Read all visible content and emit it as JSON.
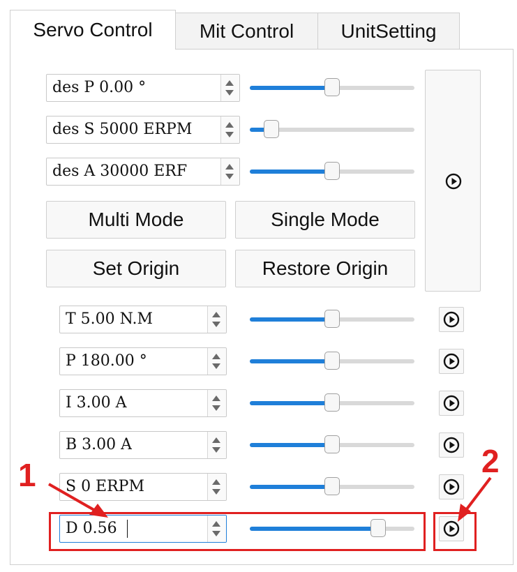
{
  "tabs": [
    {
      "label": "Servo Control",
      "active": true
    },
    {
      "label": "Mit Control",
      "active": false
    },
    {
      "label": "UnitSetting",
      "active": false
    }
  ],
  "servo": {
    "position_field": "des P 0.00 °",
    "speed_field": "des S 5000 ERPM",
    "accel_field": "des A 30000 ERF",
    "position_slider": 0.5,
    "speed_slider": 0.13,
    "accel_slider": 0.5,
    "multi_mode": "Multi Mode",
    "single_mode": "Single Mode",
    "set_origin": "Set Origin",
    "restore_origin": "Restore Origin"
  },
  "mit": [
    {
      "field": "T 5.00 N.M",
      "slider": 0.5
    },
    {
      "field": "P 180.00 °",
      "slider": 0.5
    },
    {
      "field": "I 3.00 A",
      "slider": 0.5
    },
    {
      "field": "B 3.00 A",
      "slider": 0.5
    },
    {
      "field": "S 0 ERPM",
      "slider": 0.5
    },
    {
      "field": "D 0.56",
      "slider": 0.78
    }
  ],
  "annotations": {
    "label_1": "1",
    "label_2": "2",
    "color": "#e02020"
  },
  "colors": {
    "accent": "#1f7fd9"
  }
}
